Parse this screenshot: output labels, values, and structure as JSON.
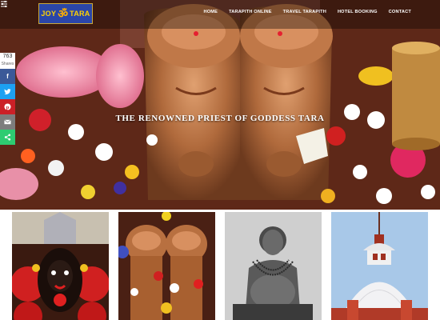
{
  "brand": {
    "word_left": "JOY",
    "symbol": "ॐ",
    "word_right": "TARA"
  },
  "nav": {
    "items": [
      {
        "label": "HOME"
      },
      {
        "label": "TARAPITH ONLINE"
      },
      {
        "label": "TRAVEL TARAPITH"
      },
      {
        "label": "HOTEL BOOKING"
      },
      {
        "label": "CONTACT"
      }
    ]
  },
  "hero": {
    "heading": "THE RENOWNED PRIEST OF GODDESS TARA"
  },
  "share": {
    "count": "763",
    "count_label": "Shares",
    "buttons": [
      {
        "icon": "facebook-icon",
        "glyph": "f",
        "color": "#3b5998"
      },
      {
        "icon": "twitter-icon",
        "glyph": "",
        "color": "#1da1f2"
      },
      {
        "icon": "pinterest-icon",
        "glyph": "",
        "color": "#cb2027"
      },
      {
        "icon": "email-icon",
        "glyph": "",
        "color": "#7d7d7d"
      },
      {
        "icon": "share-icon",
        "glyph": "",
        "color": "#2ecc71"
      }
    ]
  },
  "gallery": {
    "items": [
      {
        "subject": "goddess-tara-idol"
      },
      {
        "subject": "sacred-feet-of-tara"
      },
      {
        "subject": "sadhak-bamakhepa-portrait"
      },
      {
        "subject": "tarapith-temple-dome"
      }
    ]
  }
}
